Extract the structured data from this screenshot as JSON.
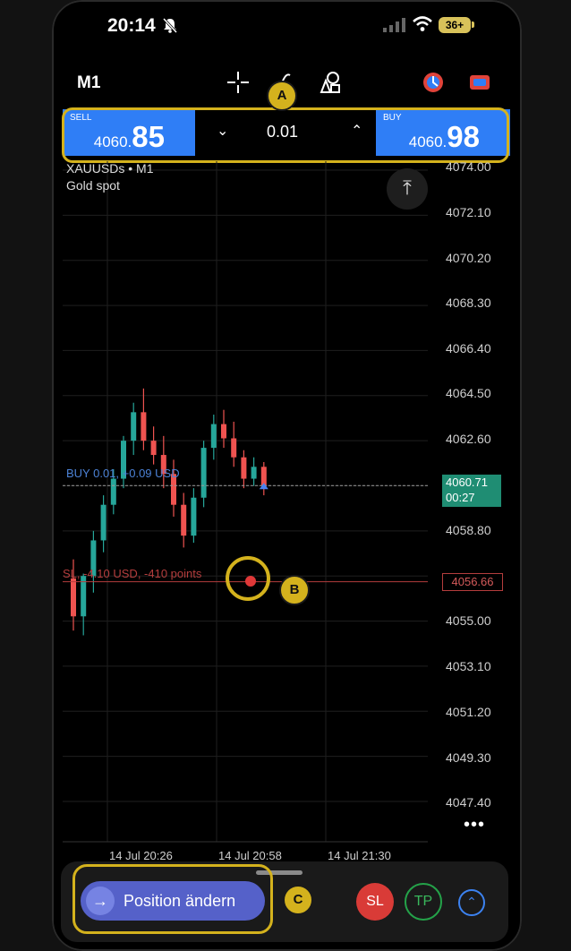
{
  "status_bar": {
    "time": "20:14",
    "battery": "36+",
    "icons": [
      "bell-off-icon",
      "signal-icon",
      "wifi-icon",
      "battery-icon"
    ]
  },
  "toolbar": {
    "timeframe": "M1",
    "tools": [
      "crosshair-icon",
      "draw-icon",
      "shapes-icon",
      "indicator-icon",
      "trade-icon"
    ]
  },
  "trade_bar": {
    "sell": {
      "label": "SELL",
      "price_small": "4060.",
      "price_big": "85"
    },
    "buy": {
      "label": "BUY",
      "price_small": "4060.",
      "price_big": "98"
    },
    "lot": "0.01"
  },
  "annotations": {
    "a": "A",
    "b": "B",
    "c": "C"
  },
  "chart": {
    "symbol": "XAUUSDs • M1",
    "description": "Gold spot",
    "price_levels": [
      "4074.00",
      "4072.10",
      "4070.20",
      "4068.30",
      "4066.40",
      "4064.50",
      "4062.60",
      "4060.71",
      "4058.80",
      "4056.66",
      "4055.00",
      "4053.10",
      "4051.20",
      "4049.30",
      "4047.40"
    ],
    "time_labels": [
      "14 Jul 20:26",
      "14 Jul 20:58",
      "14 Jul 21:30"
    ],
    "buy_line_label": "BUY 0.01, +0.09 USD",
    "buy_price": "4060.71",
    "countdown": "00:27",
    "sl_line_label": "SL, -4.10 USD, -410 points",
    "sl_price": "4056.66"
  },
  "chart_data": {
    "type": "candlestick",
    "x_range": [
      "14 Jul 20:26",
      "14 Jul 21:30"
    ],
    "ylim": [
      4047.4,
      4074.0
    ],
    "candles": [
      {
        "o": 4056.8,
        "h": 4057.6,
        "l": 4054.6,
        "c": 4055.2
      },
      {
        "o": 4055.2,
        "h": 4057.0,
        "l": 4054.4,
        "c": 4056.9
      },
      {
        "o": 4056.9,
        "h": 4058.8,
        "l": 4056.2,
        "c": 4058.4
      },
      {
        "o": 4058.4,
        "h": 4060.3,
        "l": 4057.9,
        "c": 4059.9
      },
      {
        "o": 4059.9,
        "h": 4061.4,
        "l": 4059.5,
        "c": 4061.0
      },
      {
        "o": 4061.0,
        "h": 4062.8,
        "l": 4060.6,
        "c": 4062.6
      },
      {
        "o": 4062.6,
        "h": 4064.2,
        "l": 4062.0,
        "c": 4063.8
      },
      {
        "o": 4063.8,
        "h": 4064.8,
        "l": 4062.2,
        "c": 4062.6
      },
      {
        "o": 4062.6,
        "h": 4063.2,
        "l": 4061.6,
        "c": 4062.0
      },
      {
        "o": 4062.0,
        "h": 4062.8,
        "l": 4060.6,
        "c": 4061.2
      },
      {
        "o": 4061.2,
        "h": 4061.8,
        "l": 4059.4,
        "c": 4059.9
      },
      {
        "o": 4059.9,
        "h": 4060.4,
        "l": 4058.1,
        "c": 4058.6
      },
      {
        "o": 4058.6,
        "h": 4060.6,
        "l": 4058.3,
        "c": 4060.2
      },
      {
        "o": 4060.2,
        "h": 4062.6,
        "l": 4059.8,
        "c": 4062.3
      },
      {
        "o": 4062.3,
        "h": 4063.7,
        "l": 4061.8,
        "c": 4063.3
      },
      {
        "o": 4063.3,
        "h": 4063.9,
        "l": 4062.3,
        "c": 4062.7
      },
      {
        "o": 4062.7,
        "h": 4063.4,
        "l": 4061.5,
        "c": 4061.9
      },
      {
        "o": 4061.9,
        "h": 4062.2,
        "l": 4060.6,
        "c": 4061.0
      },
      {
        "o": 4061.0,
        "h": 4061.9,
        "l": 4060.7,
        "c": 4061.5
      },
      {
        "o": 4061.5,
        "h": 4061.7,
        "l": 4060.3,
        "c": 4060.7
      }
    ],
    "buy_level": 4060.71,
    "sl_level": 4056.66
  },
  "bottom_bar": {
    "modify_label": "Position ändern",
    "sl_label": "SL",
    "tp_label": "TP"
  },
  "colors": {
    "sell_blue": "#2f7ef6",
    "highlight": "#d4b21d",
    "up": "#26a69a",
    "down": "#ef5350",
    "sl": "#d93b37",
    "tp": "#24a249"
  }
}
